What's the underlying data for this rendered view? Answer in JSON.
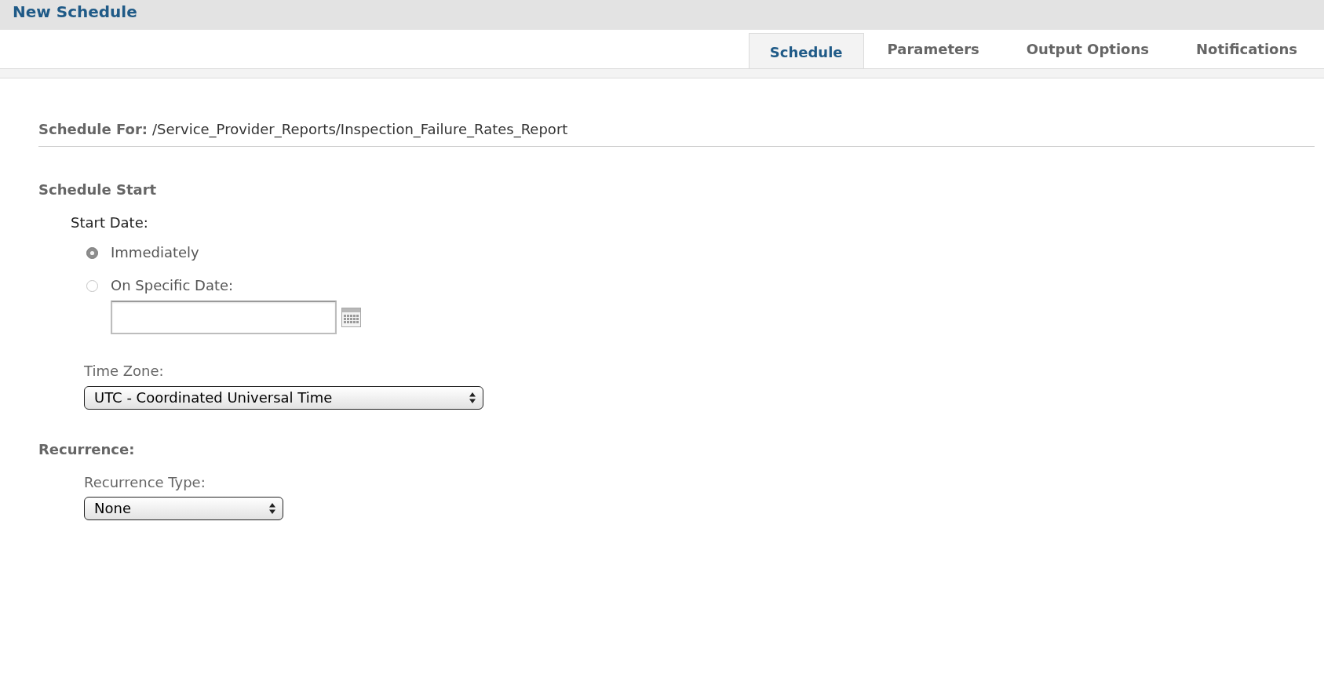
{
  "header": {
    "title": "New Schedule"
  },
  "tabs": [
    {
      "label": "Schedule",
      "selected": true
    },
    {
      "label": "Parameters",
      "selected": false
    },
    {
      "label": "Output Options",
      "selected": false
    },
    {
      "label": "Notifications",
      "selected": false
    }
  ],
  "schedule_for": {
    "label": "Schedule For:",
    "value": "/Service_Provider_Reports/Inspection_Failure_Rates_Report"
  },
  "schedule_start": {
    "heading": "Schedule Start",
    "start_date": {
      "label": "Start Date:",
      "options": [
        {
          "label": "Immediately",
          "selected": true
        },
        {
          "label": "On Specific Date:",
          "selected": false
        }
      ]
    },
    "time_zone": {
      "label": "Time Zone:",
      "value": "UTC - Coordinated Universal Time"
    }
  },
  "recurrence": {
    "heading": "Recurrence:",
    "type": {
      "label": "Recurrence Type:",
      "value": "None"
    }
  }
}
